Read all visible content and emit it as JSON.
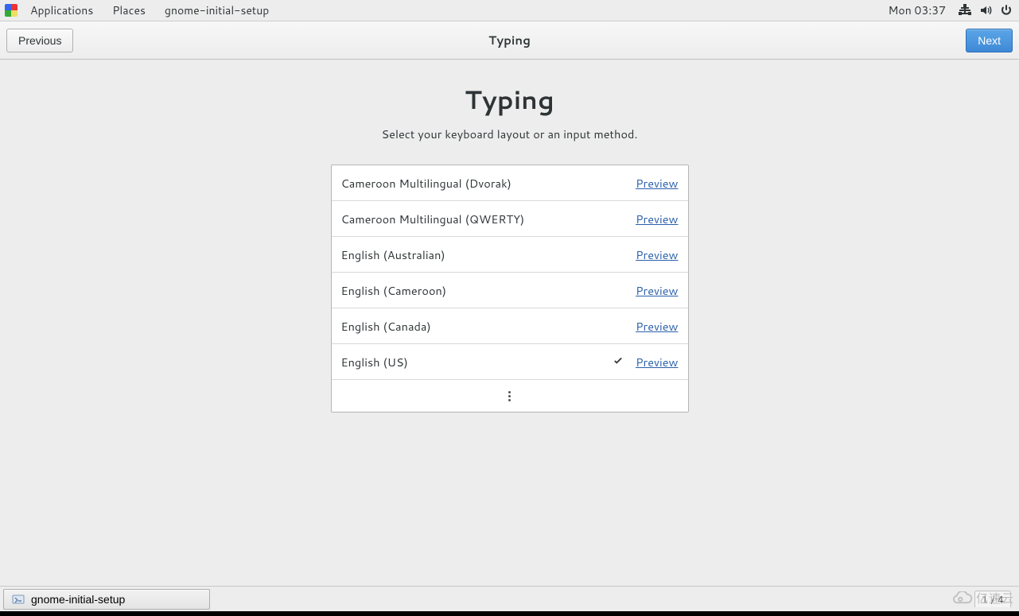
{
  "panel": {
    "applications": "Applications",
    "places": "Places",
    "app_name": "gnome-initial-setup",
    "clock": "Mon 03:37"
  },
  "headerbar": {
    "previous": "Previous",
    "title": "Typing",
    "next": "Next"
  },
  "page": {
    "heading": "Typing",
    "subtitle": "Select your keyboard layout or an input method."
  },
  "layouts": [
    {
      "name": "Cameroon Multilingual (Dvorak)",
      "preview": "Preview",
      "selected": false
    },
    {
      "name": "Cameroon Multilingual (QWERTY)",
      "preview": "Preview",
      "selected": false
    },
    {
      "name": "English (Australian)",
      "preview": "Preview",
      "selected": false
    },
    {
      "name": "English (Cameroon)",
      "preview": "Preview",
      "selected": false
    },
    {
      "name": "English (Canada)",
      "preview": "Preview",
      "selected": false
    },
    {
      "name": "English (US)",
      "preview": "Preview",
      "selected": true
    }
  ],
  "taskbar": {
    "active_app": "gnome-initial-setup",
    "page_counter": "1 / 4"
  },
  "watermark": "亿速云"
}
